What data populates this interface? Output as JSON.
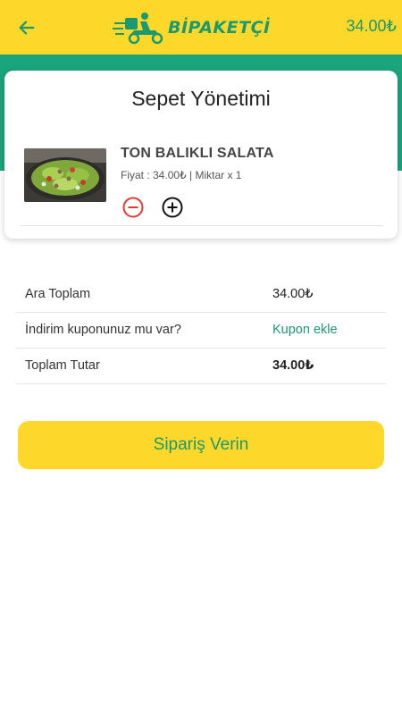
{
  "header": {
    "logo_text": "BİPAKETÇİ",
    "cart_total": "34.00₺",
    "back_icon": "arrow-left-icon",
    "logo_icon": "courier-scooter-icon"
  },
  "card": {
    "title": "Sepet Yönetimi",
    "item": {
      "name": "TON BALIKLI SALATA",
      "meta": "Fiyat : 34.00₺ | Miktar x 1",
      "image": "salad-photo",
      "minus_icon": "minus-circle-icon",
      "plus_icon": "plus-circle-icon"
    }
  },
  "summary": {
    "subtotal_label": "Ara Toplam",
    "subtotal_value": "34.00₺",
    "coupon_label": "İndirim kuponunuz mu var?",
    "coupon_action": "Kupon ekle",
    "total_label": "Toplam Tutar",
    "total_value": "34.00₺"
  },
  "order_button": "Sipariş Verin",
  "colors": {
    "yellow": "#fdd82a",
    "green": "#1ba57c",
    "text_green": "#1a9a6e",
    "minus_red": "#e53935"
  }
}
